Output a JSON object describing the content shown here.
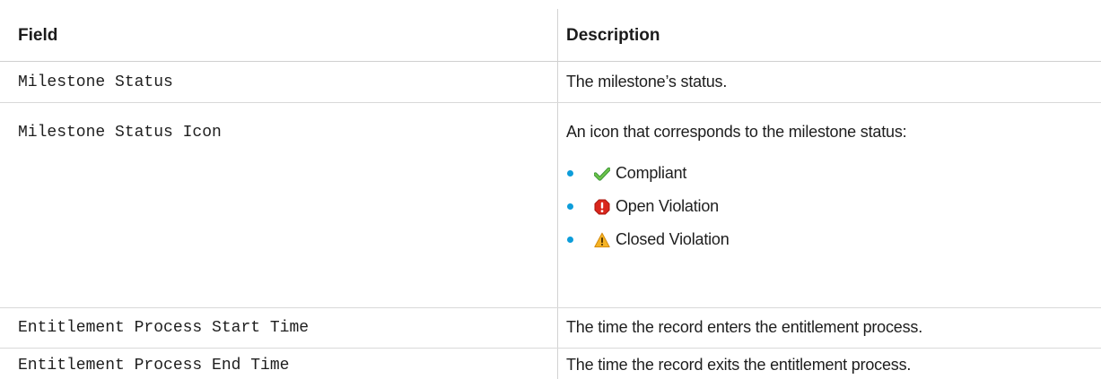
{
  "table": {
    "headers": {
      "field": "Field",
      "description": "Description"
    },
    "rows": [
      {
        "field": "Milestone Status",
        "description": "The milestone’s status."
      },
      {
        "field": "Milestone Status Icon",
        "description": "An icon that corresponds to the milestone status:",
        "bullets": [
          {
            "icon": "check-icon",
            "color": "#4caf50",
            "label": "Compliant"
          },
          {
            "icon": "error-icon",
            "color": "#d9261c",
            "label": "Open Violation"
          },
          {
            "icon": "warning-icon",
            "color": "#f2a51a",
            "label": "Closed Violation"
          }
        ]
      },
      {
        "field": "Entitlement Process Start Time",
        "description": "The time the record enters the entitlement process."
      },
      {
        "field": "Entitlement Process End Time",
        "description": "The time the record exits the entitlement process."
      }
    ]
  },
  "colors": {
    "bullet": "#0d9dda",
    "divider": "#d9d9d9",
    "text": "#1e1e1e"
  }
}
